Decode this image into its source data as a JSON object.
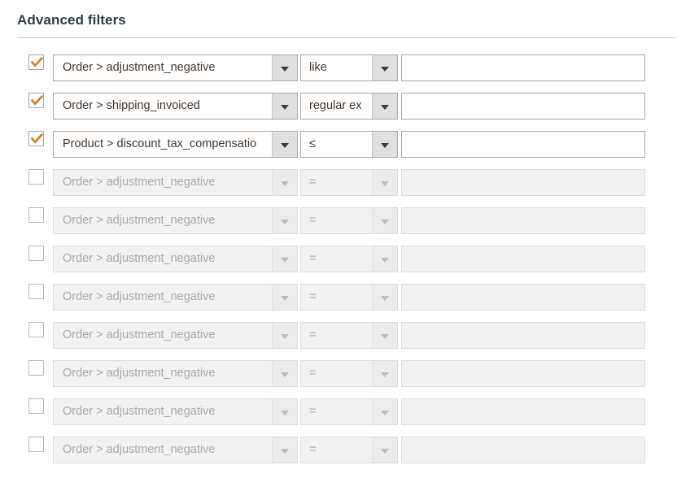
{
  "panel": {
    "title": "Advanced filters"
  },
  "icons": {
    "checkbox_check": "check-icon",
    "dropdown_arrow": "chevron-down-icon"
  },
  "colors": {
    "title": "#303d4b",
    "divider": "#ccc6b8",
    "check_mark": "#d4791f",
    "enabled_border": "#a8a8a8",
    "disabled_bg": "#f2f2f2",
    "disabled_text": "#a9a9a9",
    "dropdown_button_bg": "#e0e0e0",
    "page_bg": "#ffffff"
  },
  "rows": [
    {
      "enabled": true,
      "checked": true,
      "field": "Order > adjustment_negative",
      "operator": "like",
      "value": ""
    },
    {
      "enabled": true,
      "checked": true,
      "field": "Order > shipping_invoiced",
      "operator": "regular ex",
      "value": ""
    },
    {
      "enabled": true,
      "checked": true,
      "field": "Product > discount_tax_compensatio",
      "operator": "≤",
      "value": ""
    },
    {
      "enabled": false,
      "checked": false,
      "field": "Order > adjustment_negative",
      "operator": "=",
      "value": ""
    },
    {
      "enabled": false,
      "checked": false,
      "field": "Order > adjustment_negative",
      "operator": "=",
      "value": ""
    },
    {
      "enabled": false,
      "checked": false,
      "field": "Order > adjustment_negative",
      "operator": "=",
      "value": ""
    },
    {
      "enabled": false,
      "checked": false,
      "field": "Order > adjustment_negative",
      "operator": "=",
      "value": ""
    },
    {
      "enabled": false,
      "checked": false,
      "field": "Order > adjustment_negative",
      "operator": "=",
      "value": ""
    },
    {
      "enabled": false,
      "checked": false,
      "field": "Order > adjustment_negative",
      "operator": "=",
      "value": ""
    },
    {
      "enabled": false,
      "checked": false,
      "field": "Order > adjustment_negative",
      "operator": "=",
      "value": ""
    },
    {
      "enabled": false,
      "checked": false,
      "field": "Order > adjustment_negative",
      "operator": "=",
      "value": ""
    }
  ]
}
